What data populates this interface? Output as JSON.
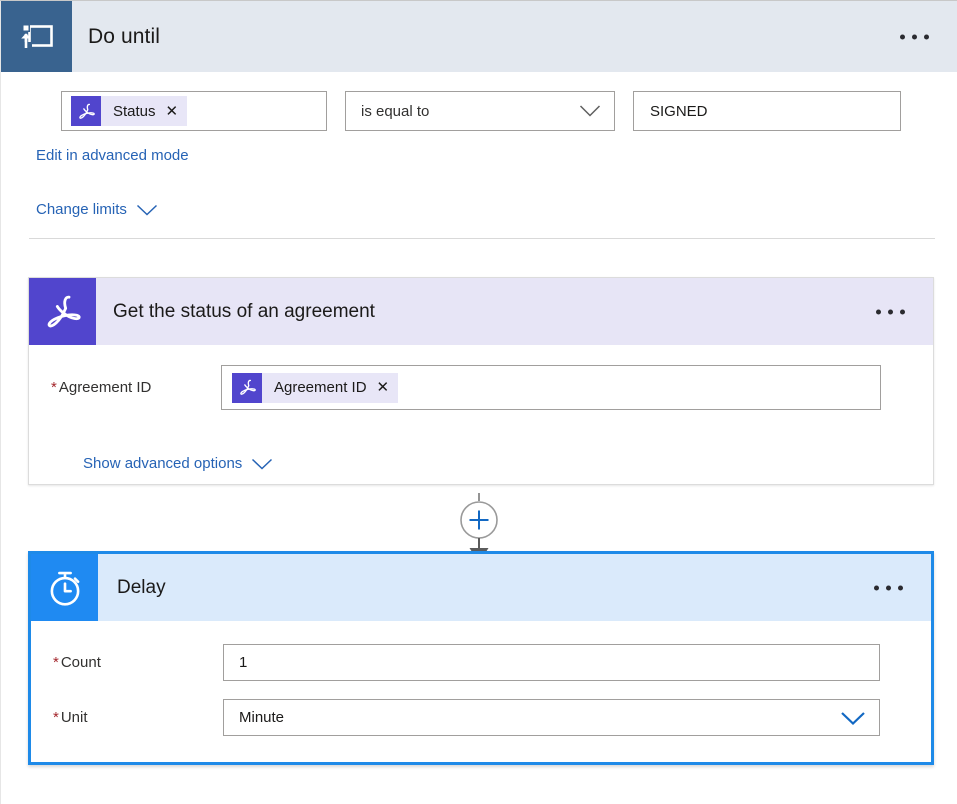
{
  "do_until": {
    "title": "Do until",
    "icon": "loop-repeat-icon",
    "overflow_menu": "…",
    "condition": {
      "left_token": {
        "label": "Status",
        "remove": "✕",
        "icon": "adobe-sign-icon"
      },
      "operator": {
        "selected": "is equal to",
        "chevron": "chevron-down-icon"
      },
      "value": "SIGNED"
    },
    "advanced_link": "Edit in advanced mode",
    "limits_link": "Change limits",
    "limits_chevron": "chevron-down-icon"
  },
  "adobe_action": {
    "title": "Get the status of an agreement",
    "icon": "adobe-sign-icon",
    "overflow_menu": "…",
    "fields": [
      {
        "required_mark": "*",
        "label": "Agreement ID",
        "token_label": "Agreement ID",
        "token_remove": "✕",
        "token_icon": "adobe-sign-icon"
      }
    ],
    "advanced_link": "Show advanced options",
    "advanced_chevron": "chevron-down-icon"
  },
  "connector": {
    "add_icon": "plus-circle-icon",
    "arrow_icon": "arrow-down-icon"
  },
  "delay_action": {
    "title": "Delay",
    "icon": "stopwatch-icon",
    "overflow_menu": "…",
    "count": {
      "required_mark": "*",
      "label": "Count",
      "value": "1"
    },
    "unit": {
      "required_mark": "*",
      "label": "Unit",
      "value": "Minute",
      "chevron": "chevron-down-icon"
    }
  },
  "colors": {
    "do_until_tile": "#39638f",
    "do_until_header_bg": "#e3e8ef",
    "adobe_purple": "#5145cd",
    "adobe_header_bg": "#e7e5f6",
    "delay_blue": "#1f8af2",
    "delay_header_bg": "#daeafb",
    "selection_border": "#1e8ae8",
    "link_blue": "#2663b5",
    "required_red": "#a4262c"
  }
}
